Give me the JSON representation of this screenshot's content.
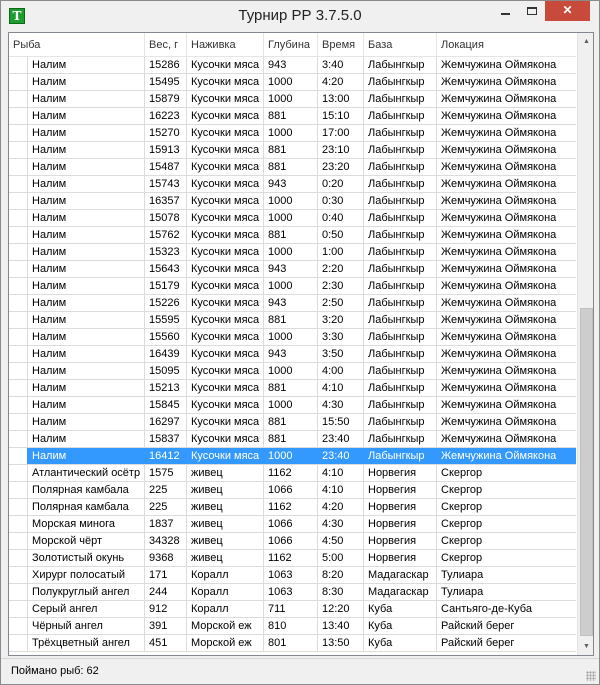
{
  "window": {
    "title": "Турнир РР 3.7.5.0",
    "icon_letter": "T",
    "icon_color": "#1f9c2f",
    "minimize_glyph": "",
    "close_glyph": "✕"
  },
  "columns": [
    "Рыба",
    "Вес, г",
    "Наживка",
    "Глубина",
    "Время",
    "База",
    "Локация"
  ],
  "rows": [
    [
      "Налим",
      "15286",
      "Кусочки мяса",
      "943",
      "3:40",
      "Лабынгкыр",
      "Жемчужина Оймякона"
    ],
    [
      "Налим",
      "15495",
      "Кусочки мяса",
      "1000",
      "4:20",
      "Лабынгкыр",
      "Жемчужина Оймякона"
    ],
    [
      "Налим",
      "15879",
      "Кусочки мяса",
      "1000",
      "13:00",
      "Лабынгкыр",
      "Жемчужина Оймякона"
    ],
    [
      "Налим",
      "16223",
      "Кусочки мяса",
      "881",
      "15:10",
      "Лабынгкыр",
      "Жемчужина Оймякона"
    ],
    [
      "Налим",
      "15270",
      "Кусочки мяса",
      "1000",
      "17:00",
      "Лабынгкыр",
      "Жемчужина Оймякона"
    ],
    [
      "Налим",
      "15913",
      "Кусочки мяса",
      "881",
      "23:10",
      "Лабынгкыр",
      "Жемчужина Оймякона"
    ],
    [
      "Налим",
      "15487",
      "Кусочки мяса",
      "881",
      "23:20",
      "Лабынгкыр",
      "Жемчужина Оймякона"
    ],
    [
      "Налим",
      "15743",
      "Кусочки мяса",
      "943",
      "0:20",
      "Лабынгкыр",
      "Жемчужина Оймякона"
    ],
    [
      "Налим",
      "16357",
      "Кусочки мяса",
      "1000",
      "0:30",
      "Лабынгкыр",
      "Жемчужина Оймякона"
    ],
    [
      "Налим",
      "15078",
      "Кусочки мяса",
      "1000",
      "0:40",
      "Лабынгкыр",
      "Жемчужина Оймякона"
    ],
    [
      "Налим",
      "15762",
      "Кусочки мяса",
      "881",
      "0:50",
      "Лабынгкыр",
      "Жемчужина Оймякона"
    ],
    [
      "Налим",
      "15323",
      "Кусочки мяса",
      "1000",
      "1:00",
      "Лабынгкыр",
      "Жемчужина Оймякона"
    ],
    [
      "Налим",
      "15643",
      "Кусочки мяса",
      "943",
      "2:20",
      "Лабынгкыр",
      "Жемчужина Оймякона"
    ],
    [
      "Налим",
      "15179",
      "Кусочки мяса",
      "1000",
      "2:30",
      "Лабынгкыр",
      "Жемчужина Оймякона"
    ],
    [
      "Налим",
      "15226",
      "Кусочки мяса",
      "943",
      "2:50",
      "Лабынгкыр",
      "Жемчужина Оймякона"
    ],
    [
      "Налим",
      "15595",
      "Кусочки мяса",
      "881",
      "3:20",
      "Лабынгкыр",
      "Жемчужина Оймякона"
    ],
    [
      "Налим",
      "15560",
      "Кусочки мяса",
      "1000",
      "3:30",
      "Лабынгкыр",
      "Жемчужина Оймякона"
    ],
    [
      "Налим",
      "16439",
      "Кусочки мяса",
      "943",
      "3:50",
      "Лабынгкыр",
      "Жемчужина Оймякона"
    ],
    [
      "Налим",
      "15095",
      "Кусочки мяса",
      "1000",
      "4:00",
      "Лабынгкыр",
      "Жемчужина Оймякона"
    ],
    [
      "Налим",
      "15213",
      "Кусочки мяса",
      "881",
      "4:10",
      "Лабынгкыр",
      "Жемчужина Оймякона"
    ],
    [
      "Налим",
      "15845",
      "Кусочки мяса",
      "1000",
      "4:30",
      "Лабынгкыр",
      "Жемчужина Оймякона"
    ],
    [
      "Налим",
      "16297",
      "Кусочки мяса",
      "881",
      "15:50",
      "Лабынгкыр",
      "Жемчужина Оймякона"
    ],
    [
      "Налим",
      "15837",
      "Кусочки мяса",
      "881",
      "23:40",
      "Лабынгкыр",
      "Жемчужина Оймякона"
    ],
    [
      "Налим",
      "16412",
      "Кусочки мяса",
      "1000",
      "23:40",
      "Лабынгкыр",
      "Жемчужина Оймякона"
    ],
    [
      "Атлантический осётр",
      "1575",
      "живец",
      "1162",
      "4:10",
      "Норвегия",
      "Скергор"
    ],
    [
      "Полярная камбала",
      "225",
      "живец",
      "1066",
      "4:10",
      "Норвегия",
      "Скергор"
    ],
    [
      "Полярная камбала",
      "225",
      "живец",
      "1162",
      "4:20",
      "Норвегия",
      "Скергор"
    ],
    [
      "Морская минога",
      "1837",
      "живец",
      "1066",
      "4:30",
      "Норвегия",
      "Скергор"
    ],
    [
      "Морской чёрт",
      "34328",
      "живец",
      "1066",
      "4:50",
      "Норвегия",
      "Скергор"
    ],
    [
      "Золотистый окунь",
      "9368",
      "живец",
      "1162",
      "5:00",
      "Норвегия",
      "Скергор"
    ],
    [
      "Хирург полосатый",
      "171",
      "Коралл",
      "1063",
      "8:20",
      "Мадагаскар",
      "Тулиара"
    ],
    [
      "Полукруглый ангел",
      "244",
      "Коралл",
      "1063",
      "8:30",
      "Мадагаскар",
      "Тулиара"
    ],
    [
      "Серый ангел",
      "912",
      "Коралл",
      "711",
      "12:20",
      "Куба",
      "Сантьяго-де-Куба"
    ],
    [
      "Чёрный ангел",
      "391",
      "Морской еж",
      "810",
      "13:40",
      "Куба",
      "Райский берег"
    ],
    [
      "Трёхцветный ангел",
      "451",
      "Морской еж",
      "801",
      "13:50",
      "Куба",
      "Райский берег"
    ]
  ],
  "selected_row": 23,
  "colors": {
    "selection": "#3399ff",
    "close_button": "#c74a3a"
  },
  "scrollbar": {
    "up_glyph": "▲",
    "down_glyph": "▼",
    "position_fraction": 1.0
  },
  "status": {
    "caught_text": "Поймано рыб: 62"
  }
}
